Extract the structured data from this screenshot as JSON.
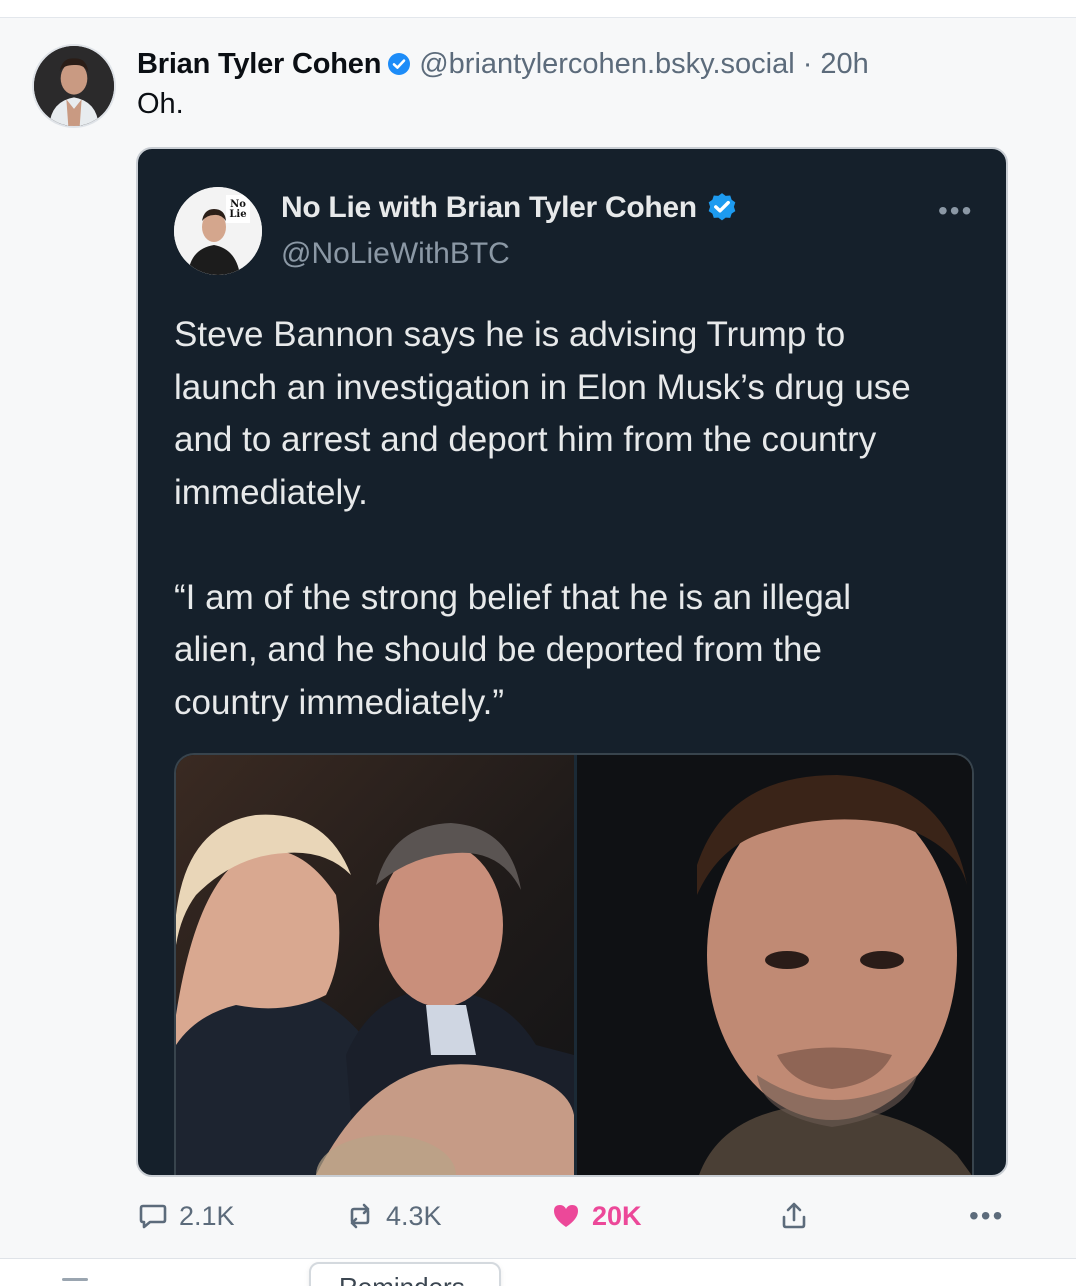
{
  "post": {
    "author": {
      "display_name": "Brian Tyler Cohen",
      "handle": "@briantylercohen.bsky.social",
      "verified": true,
      "verified_color": "#1d8cf8"
    },
    "separator": "·",
    "time_ago": "20h",
    "text": "Oh.",
    "embed": {
      "author": {
        "display_name": "No Lie with Brian Tyler Cohen",
        "handle": "@NoLieWithBTC",
        "verified": true,
        "avatar_logo_text": "No Lie"
      },
      "more_label": "•••",
      "text": "Steve Bannon says he is advising Trump to\nlaunch an investigation in Elon Musk’s drug use\nand to arrest and deport him from the country\nimmediately.\n\n“I am of the strong belief that he is an illegal\nalien, and he should be deported from the\ncountry immediately.”",
      "media": [
        {
          "icon": "photo-two-men-embracing"
        },
        {
          "icon": "photo-man-portrait"
        }
      ]
    },
    "actions": {
      "reply": {
        "icon": "reply-bubble-icon",
        "count": "2.1K"
      },
      "repost": {
        "icon": "repost-icon",
        "count": "4.3K"
      },
      "like": {
        "icon": "heart-icon",
        "count": "20K",
        "liked": true,
        "color": "#ec4899"
      },
      "share": {
        "icon": "share-icon"
      },
      "more": {
        "icon": "more-dots-icon",
        "label": "•••"
      }
    }
  },
  "reminders": {
    "label": "Reminders"
  },
  "colors": {
    "page_bg": "#f7f8f9",
    "embed_bg": "#15202b",
    "muted_text": "#5c6b7b",
    "like_pink": "#ec4899"
  }
}
